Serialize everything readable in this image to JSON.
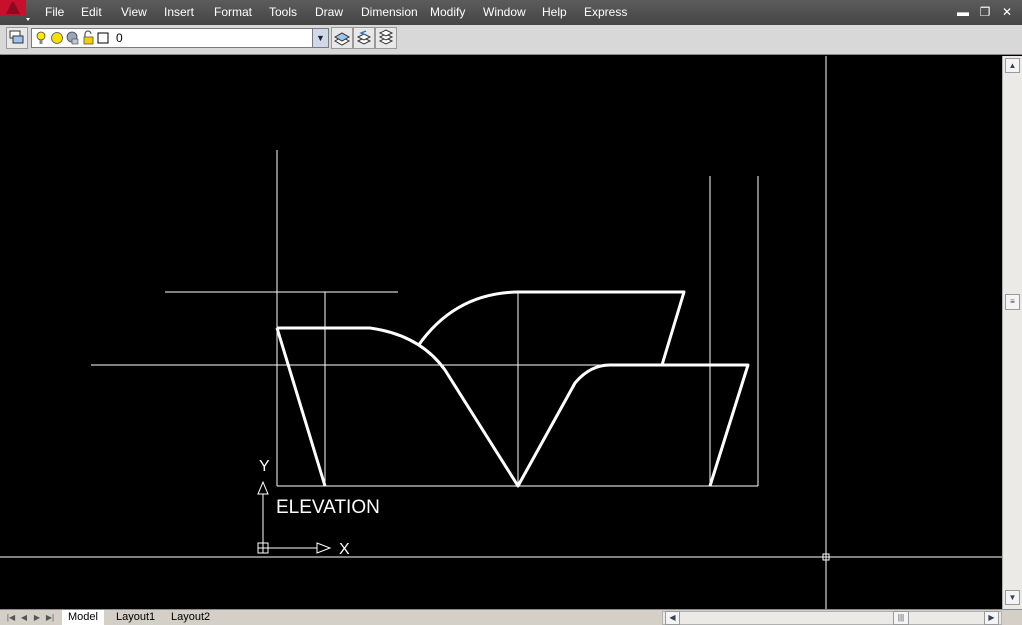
{
  "app": {
    "logo_color": "#c8102e",
    "menu": [
      "File",
      "Edit",
      "View",
      "Insert",
      "Format",
      "Tools",
      "Draw",
      "Dimension",
      "Modify",
      "Window",
      "Help",
      "Express"
    ],
    "window_controls": {
      "minimize": "▬",
      "restore": "❐",
      "close": "✕"
    }
  },
  "toolbar": {
    "layer_value": "0",
    "layer_icons": [
      "layer-manager-icon",
      "lightbulb-on-icon",
      "sun-thaw-icon",
      "viewport-freeze-icon",
      "lock-open-icon",
      "color-swatch-icon"
    ],
    "right_buttons": [
      "make-object-layer-current-icon",
      "layer-previous-icon",
      "layer-states-icon"
    ]
  },
  "drawing": {
    "label": "ELEVATION",
    "ucs": {
      "x_label": "X",
      "y_label": "Y"
    },
    "line_color": "#ffffff"
  },
  "bottom": {
    "tabs": [
      "Model",
      "Layout1",
      "Layout2"
    ],
    "active_tab": "Model"
  }
}
